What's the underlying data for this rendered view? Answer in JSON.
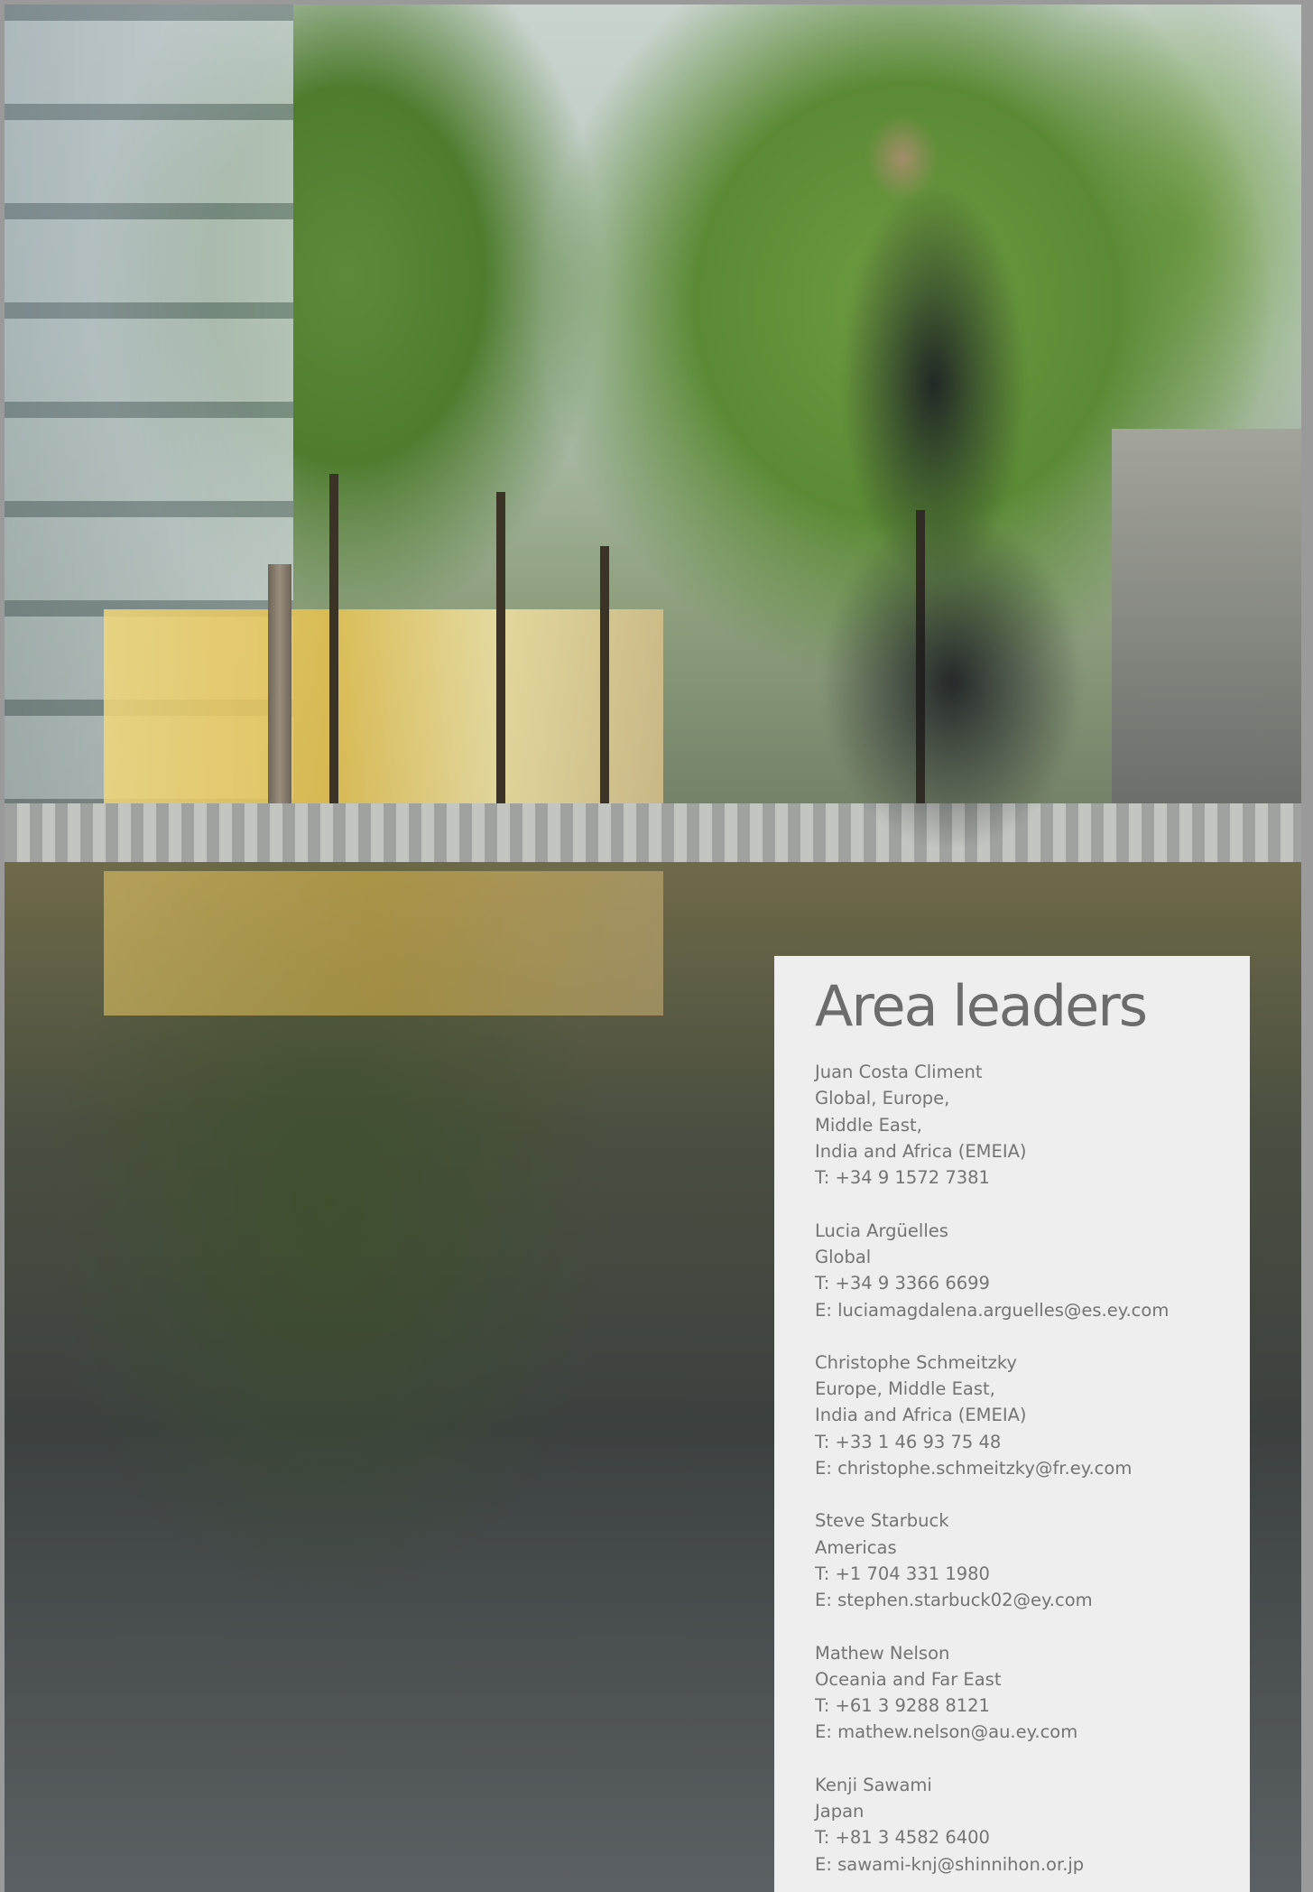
{
  "panel": {
    "title": "Area leaders",
    "leaders": [
      {
        "name": "Juan Costa Climent",
        "region": [
          "Global, Europe,",
          "Middle East,",
          "India and Africa (EMEIA)"
        ],
        "phone": "T: +34 9 1572 7381",
        "email": ""
      },
      {
        "name": "Lucia Argüelles",
        "region": [
          "Global"
        ],
        "phone": "T: +34 9 3366 6699",
        "email": "E: luciamagdalena.arguelles@es.ey.com"
      },
      {
        "name": "Christophe Schmeitzky",
        "region": [
          "Europe, Middle East,",
          "India and Africa (EMEIA)"
        ],
        "phone": "T: +33 1 46 93 75 48",
        "email": "E: christophe.schmeitzky@fr.ey.com"
      },
      {
        "name": "Steve Starbuck",
        "region": [
          "Americas"
        ],
        "phone": "T: +1 704 331 1980",
        "email": "E: stephen.starbuck02@ey.com"
      },
      {
        "name": "Mathew Nelson",
        "region": [
          "Oceania and Far East"
        ],
        "phone": "T: +61 3 9288 8121",
        "email": "E: mathew.nelson@au.ey.com"
      },
      {
        "name": "Kenji Sawami",
        "region": [
          "Japan"
        ],
        "phone": "T: +81 3 4582 6400",
        "email": "E: sawami-knj@shinnihon.or.jp"
      }
    ]
  }
}
